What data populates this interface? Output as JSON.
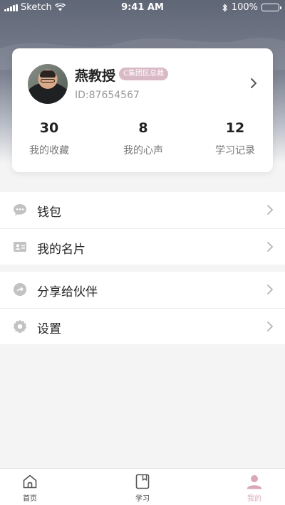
{
  "status_bar": {
    "carrier": "Sketch",
    "time": "9:41 AM",
    "battery": "100%"
  },
  "profile": {
    "name": "燕教授",
    "role_tag": "C集团区总裁",
    "id_text": "ID:87654567",
    "stats": [
      {
        "value": "30",
        "label": "我的收藏"
      },
      {
        "value": "8",
        "label": "我的心声"
      },
      {
        "value": "12",
        "label": "学习记录"
      }
    ]
  },
  "menu": {
    "group1": [
      {
        "label": "钱包",
        "icon": "chat-bubble-icon"
      },
      {
        "label": "我的名片",
        "icon": "id-card-icon"
      }
    ],
    "group2": [
      {
        "label": "分享给伙伴",
        "icon": "share-icon"
      },
      {
        "label": "设置",
        "icon": "gear-icon"
      }
    ]
  },
  "tab_bar": {
    "tabs": [
      {
        "label": "首页",
        "icon": "home-icon"
      },
      {
        "label": "学习",
        "icon": "book-icon"
      },
      {
        "label": "我的",
        "icon": "profile-icon",
        "active": true
      }
    ]
  },
  "colors": {
    "accent_pink": "#d9a6bb",
    "tag_pink": "#d9b9c6",
    "header_gray": "#5f6676"
  }
}
